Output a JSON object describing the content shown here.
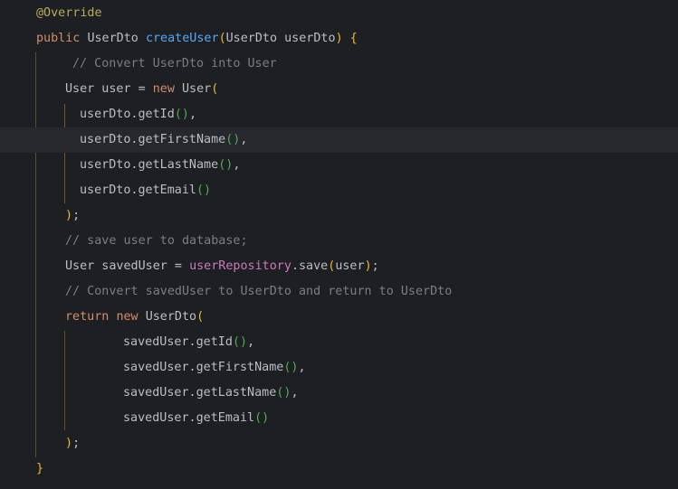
{
  "editor": {
    "lines": [
      {
        "tokens": [
          [
            "t-annot",
            "@Override"
          ]
        ]
      },
      {
        "tokens": [
          [
            "t-kw",
            "public "
          ],
          [
            "t-type",
            "UserDto "
          ],
          [
            "t-fn",
            "createUser"
          ],
          [
            "t-paren",
            "("
          ],
          [
            "t-type",
            "UserDto userDto"
          ],
          [
            "t-paren",
            ")"
          ],
          [
            "t-punc",
            " "
          ],
          [
            "t-paren",
            "{"
          ]
        ]
      },
      {
        "tokens": [
          [
            "t-cmt",
            "// Convert UserDto into User"
          ]
        ]
      },
      {
        "tokens": [
          [
            "t-type",
            "User user = "
          ],
          [
            "t-kw",
            "new "
          ],
          [
            "t-type",
            "User"
          ],
          [
            "t-paren",
            "("
          ]
        ]
      },
      {
        "tokens": [
          [
            "t-var",
            "userDto.getId"
          ],
          [
            "t-paren2",
            "()"
          ],
          [
            "t-punc",
            ","
          ]
        ]
      },
      {
        "tokens": [
          [
            "t-var",
            "userDto.getFirstName"
          ],
          [
            "t-paren2",
            "()"
          ],
          [
            "t-punc",
            ","
          ]
        ]
      },
      {
        "tokens": [
          [
            "t-var",
            "userDto.getLastName"
          ],
          [
            "t-paren2",
            "()"
          ],
          [
            "t-punc",
            ","
          ]
        ]
      },
      {
        "tokens": [
          [
            "t-var",
            "userDto.getEmail"
          ],
          [
            "t-paren2",
            "()"
          ]
        ]
      },
      {
        "tokens": [
          [
            "t-paren",
            ")"
          ],
          [
            "t-punc",
            ";"
          ]
        ]
      },
      {
        "tokens": [
          [
            "t-cmt",
            "// save user to database;"
          ]
        ]
      },
      {
        "tokens": [
          [
            "t-type",
            "User savedUser = "
          ],
          [
            "t-field",
            "userRepository"
          ],
          [
            "t-var",
            ".save"
          ],
          [
            "t-paren",
            "("
          ],
          [
            "t-var",
            "user"
          ],
          [
            "t-paren",
            ")"
          ],
          [
            "t-punc",
            ";"
          ]
        ]
      },
      {
        "tokens": [
          [
            "t-cmt",
            "// Convert savedUser to UserDto and return to UserDto"
          ]
        ]
      },
      {
        "tokens": [
          [
            "t-kw",
            "return "
          ],
          [
            "t-kw",
            "new "
          ],
          [
            "t-type",
            "UserDto"
          ],
          [
            "t-paren",
            "("
          ]
        ]
      },
      {
        "tokens": [
          [
            "t-var",
            "savedUser.getId"
          ],
          [
            "t-paren2",
            "()"
          ],
          [
            "t-punc",
            ","
          ]
        ]
      },
      {
        "tokens": [
          [
            "t-var",
            "savedUser.getFirstName"
          ],
          [
            "t-paren2",
            "()"
          ],
          [
            "t-punc",
            ","
          ]
        ]
      },
      {
        "tokens": [
          [
            "t-var",
            "savedUser.getLastName"
          ],
          [
            "t-paren2",
            "()"
          ],
          [
            "t-punc",
            ","
          ]
        ]
      },
      {
        "tokens": [
          [
            "t-var",
            "savedUser.getEmail"
          ],
          [
            "t-paren2",
            "()"
          ]
        ]
      },
      {
        "tokens": [
          [
            "t-paren",
            ")"
          ],
          [
            "t-punc",
            ";"
          ]
        ]
      },
      {
        "tokens": [
          [
            "t-paren",
            "}"
          ]
        ]
      }
    ],
    "current_line": 5
  },
  "colors": {
    "background": "#1e1f22",
    "current_line": "#26282e",
    "annotation": "#b3ae60",
    "keyword": "#cf8e6d",
    "function": "#56a8f5",
    "comment": "#7a7e85",
    "field": "#c77dbb",
    "bracket": "#e8ba36",
    "inner_paren": "#54a857"
  },
  "icons": {
    "gutter": "lightbulb-icon"
  }
}
